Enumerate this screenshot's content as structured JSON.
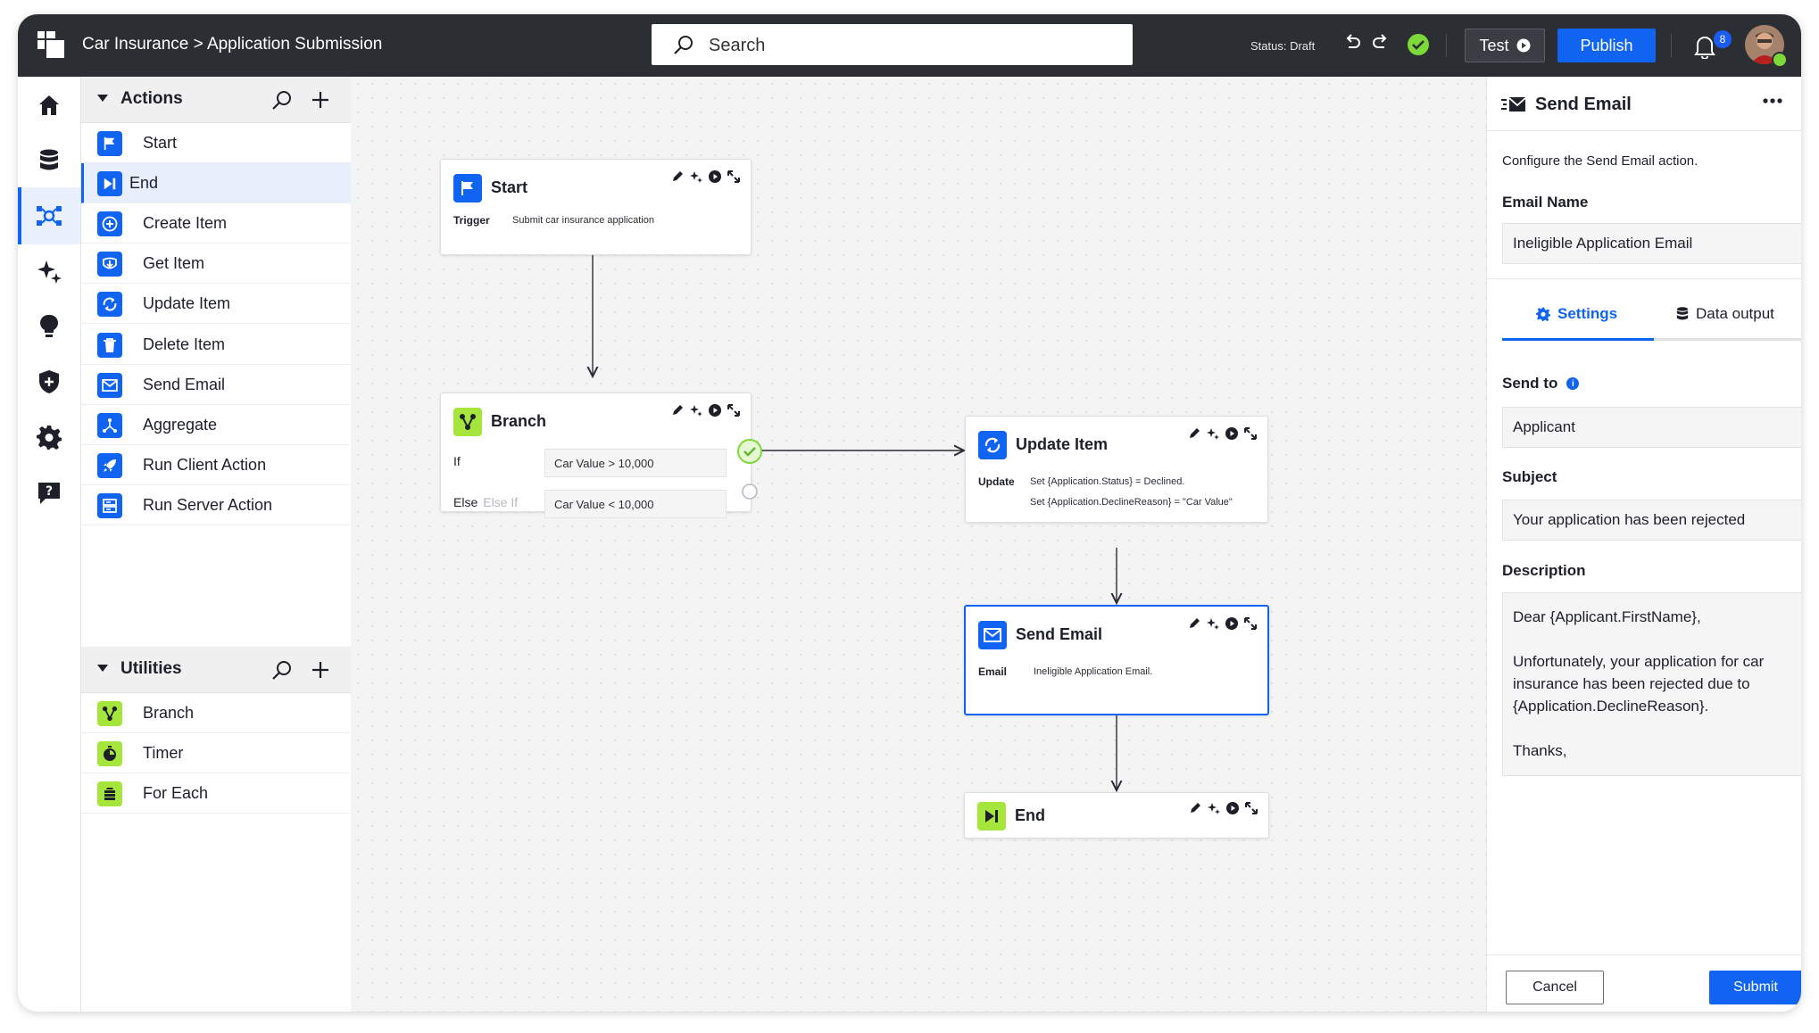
{
  "header": {
    "breadcrumb": "Car Insurance > Application Submission",
    "search_placeholder": "Search",
    "status": "Status: Draft",
    "test_label": "Test",
    "publish_label": "Publish",
    "notification_count": "8"
  },
  "rail": {
    "items": [
      "home-icon",
      "database-icon",
      "workflow-icon",
      "sparkle-icon",
      "lightbulb-icon",
      "shield-icon",
      "gear-icon",
      "help-icon"
    ],
    "active": "workflow-icon"
  },
  "palette": {
    "actions": {
      "title": "Actions",
      "items": [
        {
          "label": "Start",
          "icon": "flag-icon"
        },
        {
          "label": "End",
          "icon": "end-icon"
        },
        {
          "label": "Create Item",
          "icon": "plus-circle-icon"
        },
        {
          "label": "Get Item",
          "icon": "get-icon"
        },
        {
          "label": "Update Item",
          "icon": "update-icon"
        },
        {
          "label": "Delete Item",
          "icon": "trash-icon"
        },
        {
          "label": "Send Email",
          "icon": "email-icon"
        },
        {
          "label": "Aggregate",
          "icon": "aggregate-icon"
        },
        {
          "label": "Run Client Action",
          "icon": "rocket-icon"
        },
        {
          "label": "Run Server Action",
          "icon": "server-icon"
        }
      ],
      "selected": "End"
    },
    "utilities": {
      "title": "Utilities",
      "items": [
        {
          "label": "Branch",
          "icon": "branch-icon"
        },
        {
          "label": "Timer",
          "icon": "timer-icon"
        },
        {
          "label": "For Each",
          "icon": "foreach-icon"
        }
      ]
    }
  },
  "flow": {
    "start": {
      "title": "Start",
      "trigger_label": "Trigger",
      "trigger_value": "Submit car insurance application"
    },
    "branch": {
      "title": "Branch",
      "if_label": "If",
      "if_condition": "Car Value > 10,000",
      "else_label": "Else",
      "else_if_label": "Else If",
      "else_condition": "Car Value < 10,000"
    },
    "update": {
      "title": "Update Item",
      "update_label": "Update",
      "line1": "Set {Application.Status} = Declined.",
      "line2": "Set {Application.DeclineReason} = \"Car Value\""
    },
    "send_email": {
      "title": "Send Email",
      "email_label": "Email",
      "email_value": "Ineligible Application Email."
    },
    "end": {
      "title": "End"
    }
  },
  "panel": {
    "title": "Send Email",
    "description": "Configure the Send Email action.",
    "email_name_label": "Email Name",
    "email_name_value": "Ineligible Application Email",
    "tab_settings": "Settings",
    "tab_data_output": "Data output",
    "active_tab": "Settings",
    "send_to_label": "Send to",
    "send_to_value": "Applicant",
    "subject_label": "Subject",
    "subject_value": "Your application has been rejected",
    "description_label": "Description",
    "description_value": "Dear {Applicant.FirstName},\n\nUnfortunately, your application for car insurance has been rejected due to {Application.DeclineReason}.\n\nThanks,",
    "cancel_label": "Cancel",
    "submit_label": "Submit"
  },
  "colors": {
    "accent": "#1164f2",
    "utility_green": "#a6e63c",
    "topbar": "#2b2e33",
    "success": "#7cd938"
  }
}
